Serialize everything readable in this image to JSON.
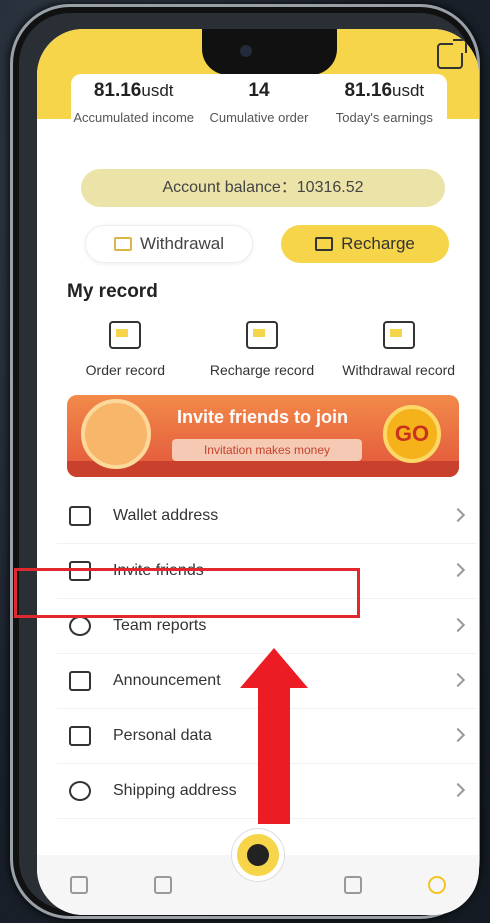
{
  "stats": [
    {
      "value": "81.16",
      "unit": "usdt",
      "label": "Accumulated income"
    },
    {
      "value": "14",
      "unit": "",
      "label": "Cumulative order"
    },
    {
      "value": "81.16",
      "unit": "usdt",
      "label": "Today's earnings"
    }
  ],
  "balance": {
    "label": "Account balance：10316.52"
  },
  "actions": {
    "withdraw": "Withdrawal",
    "recharge": "Recharge"
  },
  "my_record": {
    "title": "My record",
    "items": [
      {
        "label": "Order record",
        "icon": "order-record-icon"
      },
      {
        "label": "Recharge record",
        "icon": "recharge-record-icon"
      },
      {
        "label": "Withdrawal record",
        "icon": "withdrawal-record-icon"
      }
    ]
  },
  "banner": {
    "title": "Invite friends to join",
    "subtitle": "Invitation makes money",
    "go": "GO"
  },
  "menu": [
    {
      "label": "Wallet address",
      "icon": "wallet-icon"
    },
    {
      "label": "Invite friends",
      "icon": "gift-icon"
    },
    {
      "label": "Team reports",
      "icon": "team-icon"
    },
    {
      "label": "Announcement",
      "icon": "announcement-icon"
    },
    {
      "label": "Personal data",
      "icon": "id-card-icon"
    },
    {
      "label": "Shipping address",
      "icon": "location-pin-icon"
    }
  ],
  "colors": {
    "accent": "#f6d54a",
    "highlight": "#e0282e"
  }
}
